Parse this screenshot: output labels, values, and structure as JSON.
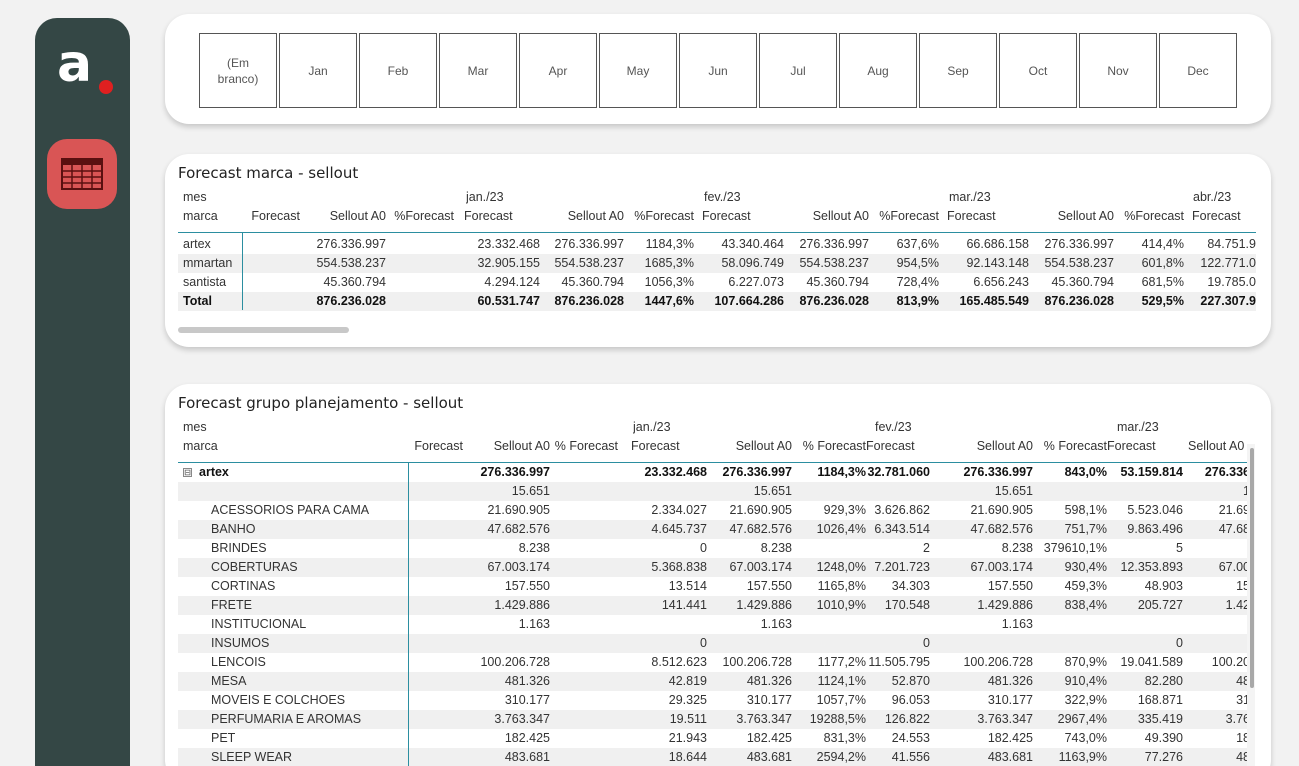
{
  "months": [
    "(Em branco)",
    "Jan",
    "Feb",
    "Mar",
    "Apr",
    "May",
    "Jun",
    "Jul",
    "Aug",
    "Sep",
    "Oct",
    "Nov",
    "Dec"
  ],
  "brand_table": {
    "title": "Forecast marca - sellout",
    "row_header_top": "mes",
    "row_header": "marca",
    "period_labels": [
      "jan./23",
      "fev./23",
      "mar./23",
      "abr./23"
    ],
    "columns": [
      "Forecast",
      "Sellout A0",
      "%Forecast",
      "Forecast",
      "Sellout A0",
      "%Forecast",
      "Forecast",
      "Sellout A0",
      "%Forecast",
      "Forecast",
      "Sellout A0",
      "%Forecast",
      "Forecast"
    ],
    "rows": [
      {
        "label": "artex",
        "cells": [
          "",
          "276.336.997",
          "",
          "23.332.468",
          "276.336.997",
          "1184,3%",
          "43.340.464",
          "276.336.997",
          "637,6%",
          "66.686.158",
          "276.336.997",
          "414,4%",
          "84.751.9"
        ]
      },
      {
        "label": "mmartan",
        "cells": [
          "",
          "554.538.237",
          "",
          "32.905.155",
          "554.538.237",
          "1685,3%",
          "58.096.749",
          "554.538.237",
          "954,5%",
          "92.143.148",
          "554.538.237",
          "601,8%",
          "122.771.0"
        ]
      },
      {
        "label": "santista",
        "cells": [
          "",
          "45.360.794",
          "",
          "4.294.124",
          "45.360.794",
          "1056,3%",
          "6.227.073",
          "45.360.794",
          "728,4%",
          "6.656.243",
          "45.360.794",
          "681,5%",
          "19.785.0"
        ]
      },
      {
        "label": "Total",
        "cells": [
          "",
          "876.236.028",
          "",
          "60.531.747",
          "876.236.028",
          "1447,6%",
          "107.664.286",
          "876.236.028",
          "813,9%",
          "165.485.549",
          "876.236.028",
          "529,5%",
          "227.307.9"
        ]
      }
    ]
  },
  "group_table": {
    "title": "Forecast grupo planejamento - sellout",
    "row_header_top": "mes",
    "row_header": "marca",
    "period_labels": [
      "jan./23",
      "fev./23",
      "mar./23"
    ],
    "columns": [
      "Forecast",
      "Sellout A0",
      "% Forecast",
      "Forecast",
      "Sellout A0",
      "% Forecast",
      "Forecast",
      "Sellout A0",
      "% Forecast",
      "Forecast",
      "Sellout A0"
    ],
    "collapse_icon": "⊟",
    "rows": [
      {
        "label": "artex",
        "cells": [
          "",
          "276.336.997",
          "",
          "23.332.468",
          "276.336.997",
          "1184,3%",
          "32.781.060",
          "276.336.997",
          "843,0%",
          "53.159.814",
          "276.336"
        ]
      },
      {
        "label": "",
        "cells": [
          "",
          "15.651",
          "",
          "",
          "15.651",
          "",
          "",
          "15.651",
          "",
          "",
          "1"
        ]
      },
      {
        "label": "ACESSORIOS PARA CAMA",
        "cells": [
          "",
          "21.690.905",
          "",
          "2.334.027",
          "21.690.905",
          "929,3%",
          "3.626.862",
          "21.690.905",
          "598,1%",
          "5.523.046",
          "21.69"
        ]
      },
      {
        "label": "BANHO",
        "cells": [
          "",
          "47.682.576",
          "",
          "4.645.737",
          "47.682.576",
          "1026,4%",
          "6.343.514",
          "47.682.576",
          "751,7%",
          "9.863.496",
          "47.68"
        ]
      },
      {
        "label": "BRINDES",
        "cells": [
          "",
          "8.238",
          "",
          "0",
          "8.238",
          "",
          "2",
          "8.238",
          "379610,1%",
          "5",
          ""
        ]
      },
      {
        "label": "COBERTURAS",
        "cells": [
          "",
          "67.003.174",
          "",
          "5.368.838",
          "67.003.174",
          "1248,0%",
          "7.201.723",
          "67.003.174",
          "930,4%",
          "12.353.893",
          "67.00"
        ]
      },
      {
        "label": "CORTINAS",
        "cells": [
          "",
          "157.550",
          "",
          "13.514",
          "157.550",
          "1165,8%",
          "34.303",
          "157.550",
          "459,3%",
          "48.903",
          "15"
        ]
      },
      {
        "label": "FRETE",
        "cells": [
          "",
          "1.429.886",
          "",
          "141.441",
          "1.429.886",
          "1010,9%",
          "170.548",
          "1.429.886",
          "838,4%",
          "205.727",
          "1.42"
        ]
      },
      {
        "label": "INSTITUCIONAL",
        "cells": [
          "",
          "1.163",
          "",
          "",
          "1.163",
          "",
          "",
          "1.163",
          "",
          "",
          ""
        ]
      },
      {
        "label": "INSUMOS",
        "cells": [
          "",
          "",
          "",
          "0",
          "",
          "",
          "0",
          "",
          "",
          "0",
          ""
        ]
      },
      {
        "label": "LENCOIS",
        "cells": [
          "",
          "100.206.728",
          "",
          "8.512.623",
          "100.206.728",
          "1177,2%",
          "11.505.795",
          "100.206.728",
          "870,9%",
          "19.041.589",
          "100.20"
        ]
      },
      {
        "label": "MESA",
        "cells": [
          "",
          "481.326",
          "",
          "42.819",
          "481.326",
          "1124,1%",
          "52.870",
          "481.326",
          "910,4%",
          "82.280",
          "48"
        ]
      },
      {
        "label": "MOVEIS E COLCHOES",
        "cells": [
          "",
          "310.177",
          "",
          "29.325",
          "310.177",
          "1057,7%",
          "96.053",
          "310.177",
          "322,9%",
          "168.871",
          "31"
        ]
      },
      {
        "label": "PERFUMARIA E AROMAS",
        "cells": [
          "",
          "3.763.347",
          "",
          "19.511",
          "3.763.347",
          "19288,5%",
          "126.822",
          "3.763.347",
          "2967,4%",
          "335.419",
          "3.76"
        ]
      },
      {
        "label": "PET",
        "cells": [
          "",
          "182.425",
          "",
          "21.943",
          "182.425",
          "831,3%",
          "24.553",
          "182.425",
          "743,0%",
          "49.390",
          "18"
        ]
      },
      {
        "label": "SLEEP WEAR",
        "cells": [
          "",
          "483.681",
          "",
          "18.644",
          "483.681",
          "2594,2%",
          "41.556",
          "483.681",
          "1163,9%",
          "77.276",
          "48"
        ]
      }
    ]
  },
  "nav": {
    "logo_letter": "a.",
    "table_icon": "table-icon"
  },
  "colors": {
    "rail": "#344745",
    "nav_button": "#d95555",
    "accent_line": "#2b8ea0",
    "logo_dot": "#e02020"
  }
}
